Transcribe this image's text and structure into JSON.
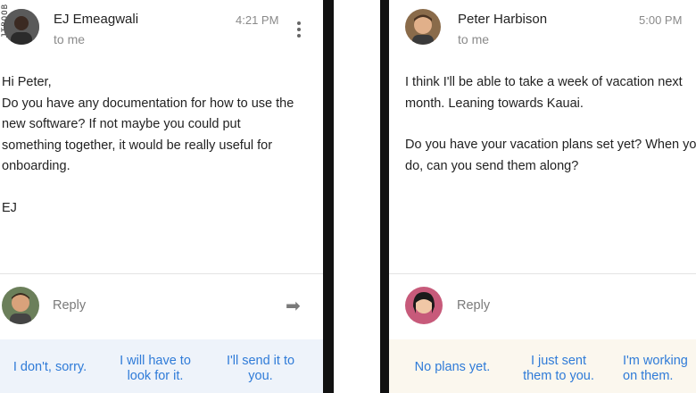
{
  "watermark": "JTBOOB",
  "left_email": {
    "sender_name": "EJ Emeagwali",
    "recipient": "to me",
    "time": "4:21 PM",
    "body": [
      "Hi Peter,\nDo you have any documentation for how to use the\nnew software? If not maybe you could put\nsomething together, it would be really useful for\nonboarding.",
      "EJ"
    ],
    "reply_label": "Reply",
    "suggestions": [
      "I don't, sorry.",
      "I will have to\nlook for it.",
      "I'll send it to\nyou."
    ],
    "menu_icon": "more-vert-icon",
    "send_icon": "arrow-right-icon"
  },
  "right_email": {
    "sender_name": "Peter Harbison",
    "recipient": "to me",
    "time": "5:00 PM",
    "body": [
      "I think I'll be able to take a week of vacation next\nmonth. Leaning towards Kauai.",
      "Do you have your vacation plans set yet? When you\ndo, can you send them along?"
    ],
    "reply_label": "Reply",
    "suggestions": [
      "No plans yet.",
      "I just sent\nthem to you.",
      "I'm working\non them."
    ]
  },
  "colors": {
    "suggestion_text": "#2f7bd8",
    "left_suggestion_bg": "#eef3fa",
    "right_suggestion_bg": "#fbf7ee",
    "background": "#1c1c1c"
  }
}
